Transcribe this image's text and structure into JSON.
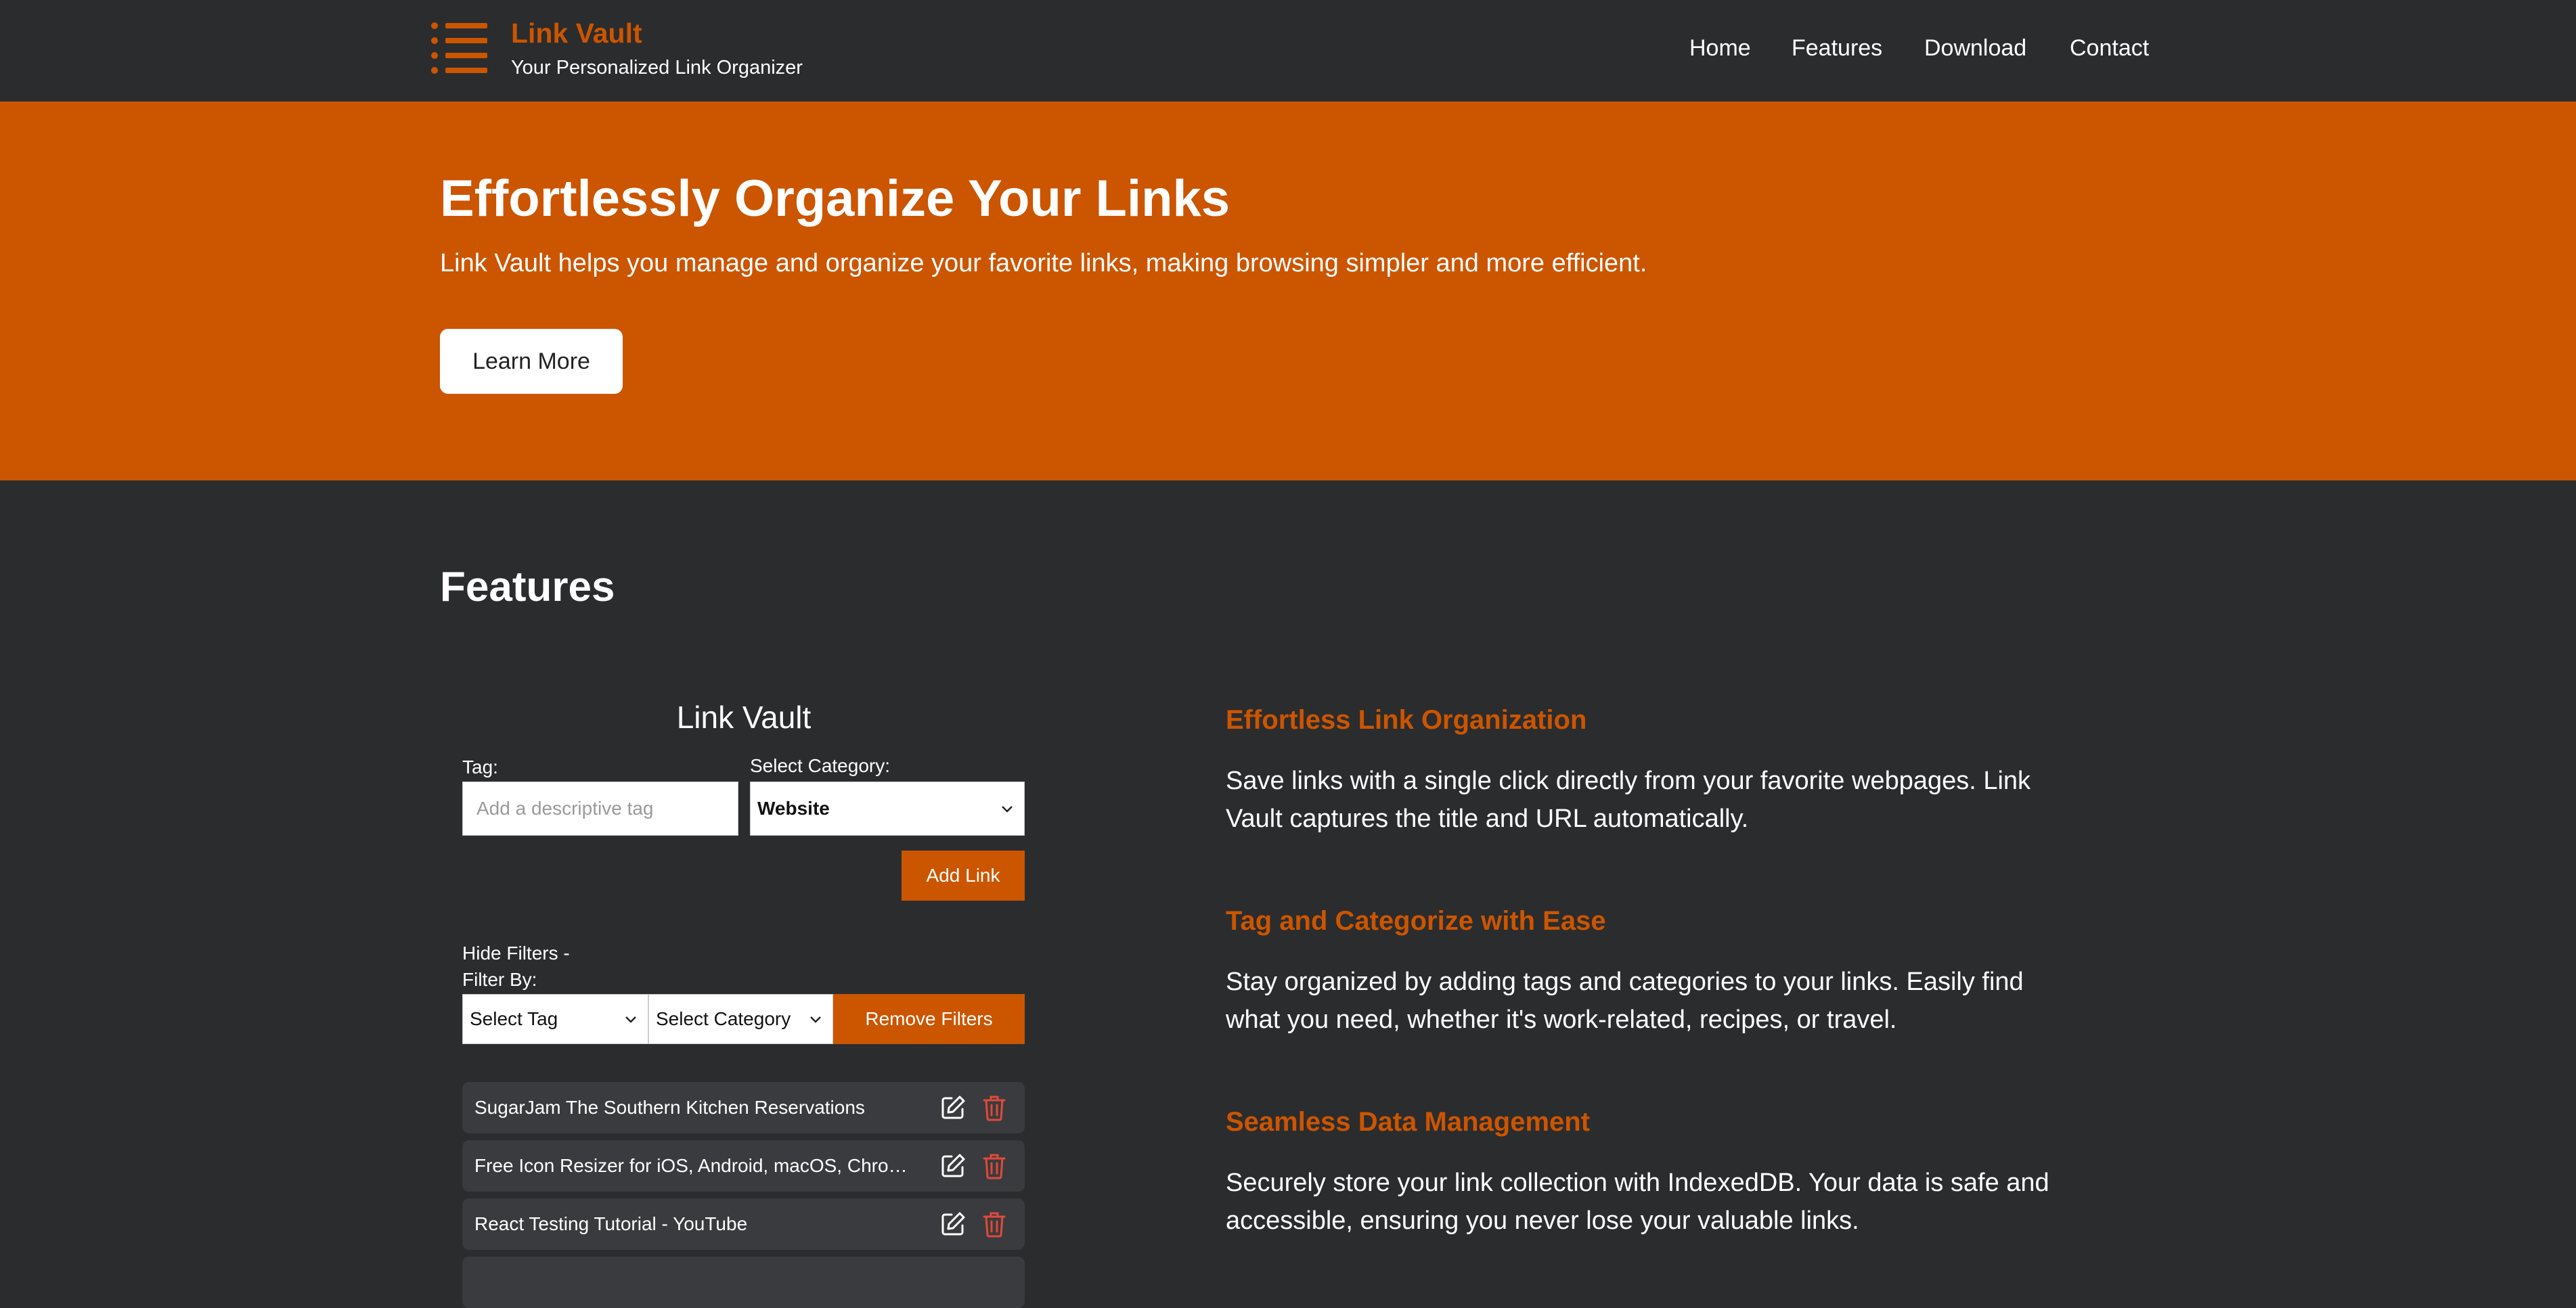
{
  "brand": {
    "title": "Link Vault",
    "subtitle": "Your Personalized Link Organizer",
    "icon": "list-icon"
  },
  "nav": {
    "links": [
      {
        "label": "Home"
      },
      {
        "label": "Features"
      },
      {
        "label": "Download"
      },
      {
        "label": "Contact"
      }
    ]
  },
  "hero": {
    "title": "Effortlessly Organize Your Links",
    "text": "Link Vault helps you manage and organize your favorite links, making browsing simpler and more efficient.",
    "button_label": "Learn More"
  },
  "features_section": {
    "title": "Features"
  },
  "widget": {
    "title": "Link Vault",
    "tag_label": "Tag:",
    "tag_placeholder": "Add a descriptive tag",
    "tag_value": "",
    "category_label": "Select Category:",
    "category_value": "Website",
    "add_link_label": "Add Link",
    "hide_filters_label": "Hide Filters -",
    "filter_by_label": "Filter By:",
    "tag_filter_value": "Select Tag",
    "category_filter_value": "Select Category",
    "remove_filters_label": "Remove Filters",
    "links": [
      {
        "text": "SugarJam The Southern Kitchen Reservations"
      },
      {
        "text": "Free Icon Resizer for iOS, Android, macOS, Chrome Extensions"
      },
      {
        "text": "React Testing Tutorial - YouTube"
      },
      {
        "text": ""
      }
    ]
  },
  "features": [
    {
      "heading": "Effortless Link Organization",
      "text": "Save links with a single click directly from your favorite webpages. Link Vault captures the title and URL automatically."
    },
    {
      "heading": "Tag and Categorize with Ease",
      "text": "Stay organized by adding tags and categories to your links. Easily find what you need, whether it's work-related, recipes, or travel."
    },
    {
      "heading": "Seamless Data Management",
      "text": "Securely store your link collection with IndexedDB. Your data is safe and accessible, ensuring you never lose your valuable links."
    }
  ],
  "colors": {
    "accent": "#cc5500",
    "background": "#2b2c2e",
    "item_background": "#3a3b3e",
    "delete": "#e04a3a"
  }
}
